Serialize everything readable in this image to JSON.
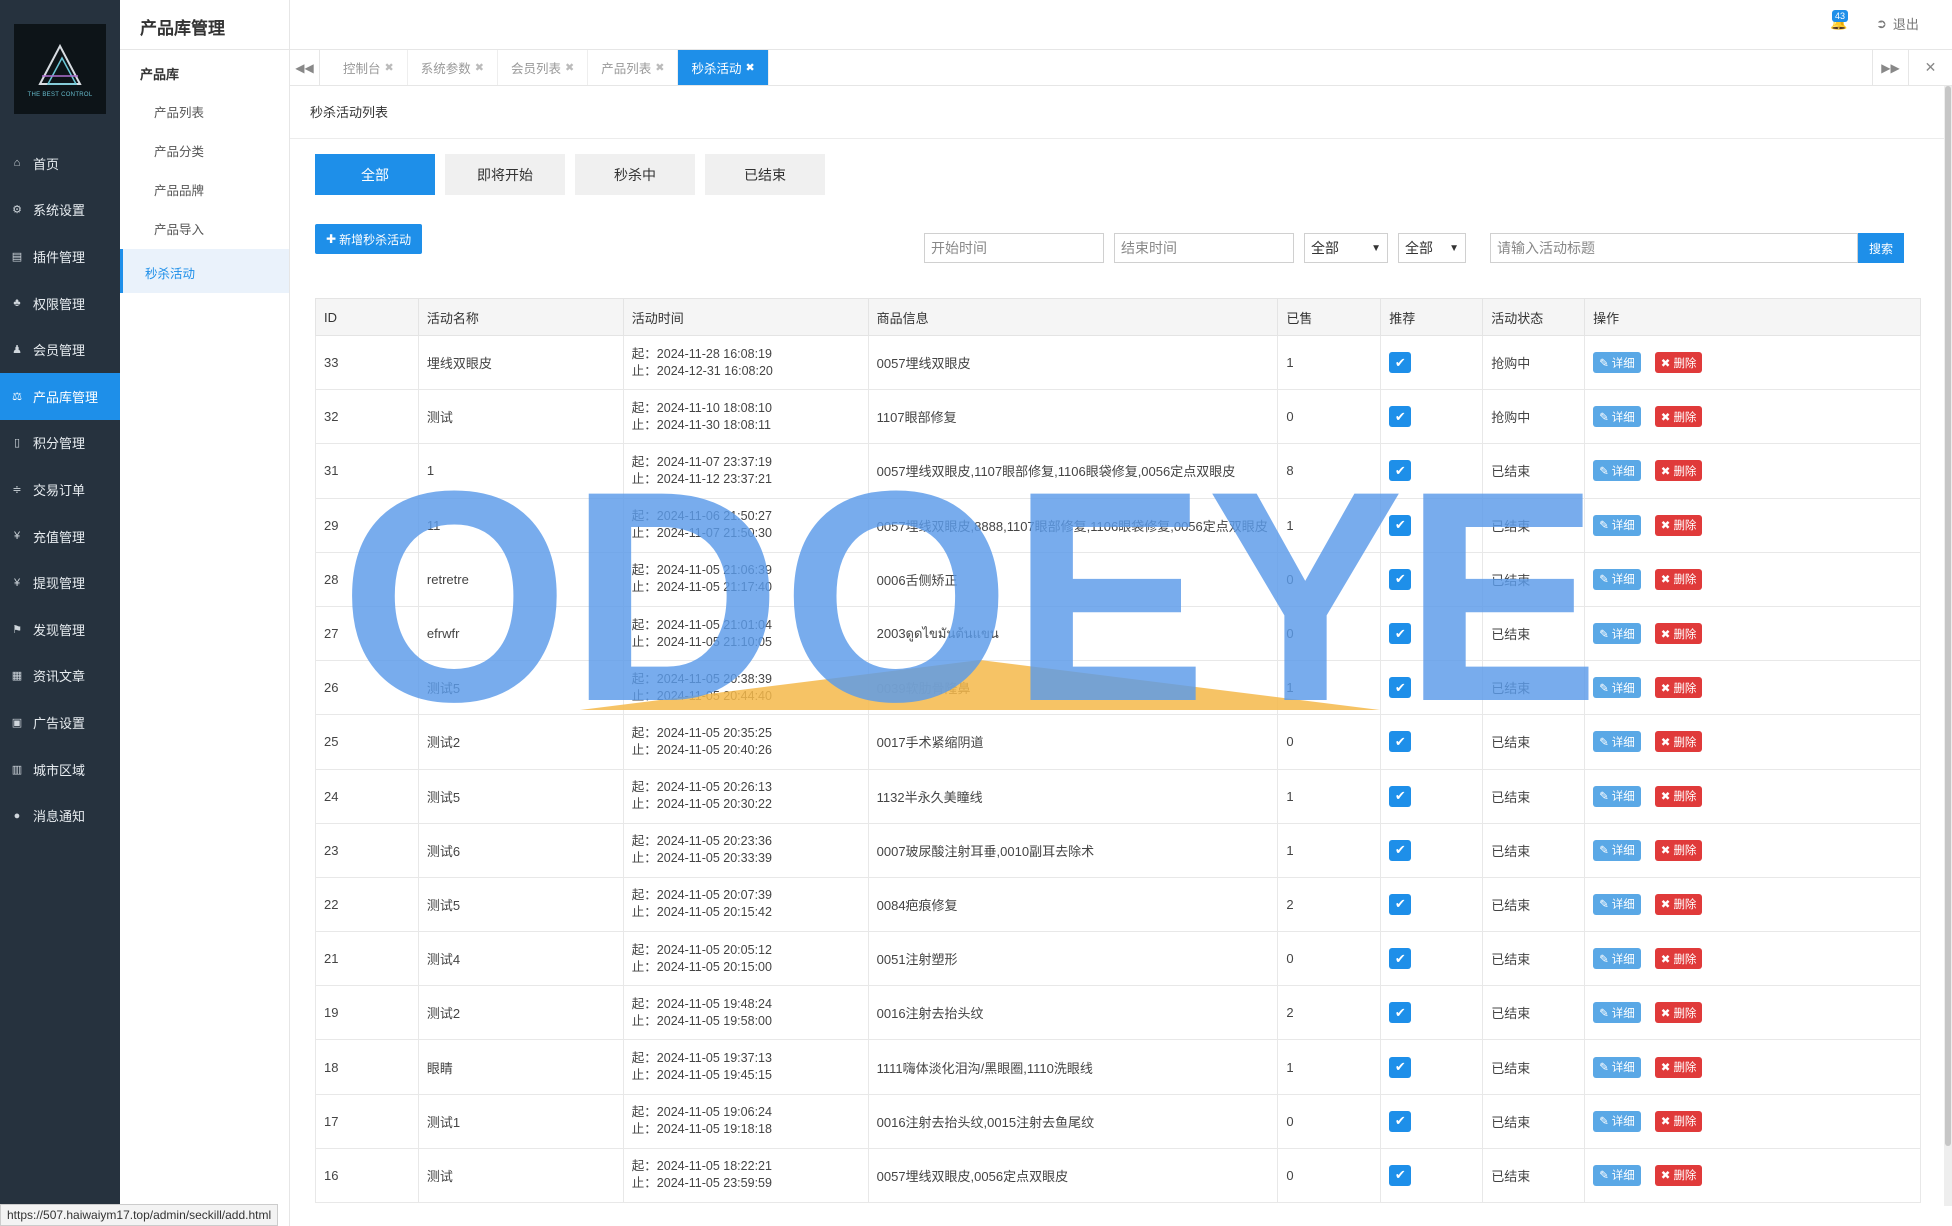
{
  "sidebar": {
    "logo_text": "THE BEST CONTROL",
    "items": [
      {
        "label": "首页",
        "icon": "home-icon",
        "glyph": "⌂"
      },
      {
        "label": "系统设置",
        "icon": "gear-icon",
        "glyph": "⚙"
      },
      {
        "label": "插件管理",
        "icon": "plugin-icon",
        "glyph": "▤"
      },
      {
        "label": "权限管理",
        "icon": "sitemap-icon",
        "glyph": "♣"
      },
      {
        "label": "会员管理",
        "icon": "users-icon",
        "glyph": "♟"
      },
      {
        "label": "产品库管理",
        "icon": "scale-icon",
        "glyph": "⚖"
      },
      {
        "label": "积分管理",
        "icon": "file-icon",
        "glyph": "▯"
      },
      {
        "label": "交易订单",
        "icon": "sliders-icon",
        "glyph": "≑"
      },
      {
        "label": "充值管理",
        "icon": "yen-icon",
        "glyph": "¥"
      },
      {
        "label": "提现管理",
        "icon": "yen-icon",
        "glyph": "¥"
      },
      {
        "label": "发现管理",
        "icon": "flag-icon",
        "glyph": "⚑"
      },
      {
        "label": "资讯文章",
        "icon": "newspaper-icon",
        "glyph": "▦"
      },
      {
        "label": "广告设置",
        "icon": "image-icon",
        "glyph": "▣"
      },
      {
        "label": "城市区域",
        "icon": "map-icon",
        "glyph": "▥"
      },
      {
        "label": "消息通知",
        "icon": "comment-icon",
        "glyph": "●"
      }
    ]
  },
  "subside": {
    "title": "产品库管理",
    "group": "产品库",
    "items": [
      "产品列表",
      "产品分类",
      "产品品牌",
      "产品导入"
    ],
    "active_item": "秒杀活动"
  },
  "topbar": {
    "notification_count": "43",
    "logout_label": "退出"
  },
  "tabs": [
    {
      "label": "控制台"
    },
    {
      "label": "系统参数"
    },
    {
      "label": "会员列表"
    },
    {
      "label": "产品列表"
    },
    {
      "label": "秒杀活动"
    }
  ],
  "panel": {
    "title": "秒杀活动列表",
    "filter_tabs": [
      "全部",
      "即将开始",
      "秒杀中",
      "已结束"
    ],
    "add_button": "新增秒杀活动",
    "search": {
      "start_placeholder": "开始时间",
      "end_placeholder": "结束时间",
      "select1_value": "全部",
      "select2_value": "全部",
      "title_placeholder": "请输入活动标题",
      "button": "搜索"
    }
  },
  "table": {
    "headers": [
      "ID",
      "活动名称",
      "活动时间",
      "商品信息",
      "已售",
      "推荐",
      "活动状态",
      "操作"
    ],
    "detail_label": "详细",
    "delete_label": "删除",
    "rows": [
      {
        "id": "33",
        "name": "埋线双眼皮",
        "start": "起：2024-11-28 16:08:19",
        "end": "止：2024-12-31 16:08:20",
        "goods": "0057埋线双眼皮",
        "sold": "1",
        "status": "抢购中",
        "active": true
      },
      {
        "id": "32",
        "name": "测试",
        "start": "起：2024-11-10 18:08:10",
        "end": "止：2024-11-30 18:08:11",
        "goods": "1107眼部修复",
        "sold": "0",
        "status": "抢购中",
        "active": true
      },
      {
        "id": "31",
        "name": "1",
        "start": "起：2024-11-07 23:37:19",
        "end": "止：2024-11-12 23:37:21",
        "goods": "0057埋线双眼皮,1107眼部修复,1106眼袋修复,0056定点双眼皮",
        "sold": "8",
        "status": "已结束",
        "active": false
      },
      {
        "id": "29",
        "name": "11",
        "start": "起：2024-11-06 21:50:27",
        "end": "止：2024-11-07 21:50:30",
        "goods": "0057埋线双眼皮,8888,1107眼部修复,1106眼袋修复,0056定点双眼皮",
        "sold": "1",
        "status": "已结束",
        "active": false
      },
      {
        "id": "28",
        "name": "retretre",
        "start": "起：2024-11-05 21:06:39",
        "end": "止：2024-11-05 21:17:40",
        "goods": "0006舌侧矫正",
        "sold": "0",
        "status": "已结束",
        "active": false
      },
      {
        "id": "27",
        "name": "efrwfr",
        "start": "起：2024-11-05 21:01:04",
        "end": "止：2024-11-05 21:10:05",
        "goods": "2003ดูดไขมันต้นแขน",
        "sold": "0",
        "status": "已结束",
        "active": false
      },
      {
        "id": "26",
        "name": "测试5",
        "start": "起：2024-11-05 20:38:39",
        "end": "止：2024-11-05 20:44:40",
        "goods": "0039软肋骨隆鼻",
        "sold": "1",
        "status": "已结束",
        "active": false
      },
      {
        "id": "25",
        "name": "测试2",
        "start": "起：2024-11-05 20:35:25",
        "end": "止：2024-11-05 20:40:26",
        "goods": "0017手术紧缩阴道",
        "sold": "0",
        "status": "已结束",
        "active": false
      },
      {
        "id": "24",
        "name": "测试5",
        "start": "起：2024-11-05 20:26:13",
        "end": "止：2024-11-05 20:30:22",
        "goods": "1132半永久美瞳线",
        "sold": "1",
        "status": "已结束",
        "active": false
      },
      {
        "id": "23",
        "name": "测试6",
        "start": "起：2024-11-05 20:23:36",
        "end": "止：2024-11-05 20:33:39",
        "goods": "0007玻尿酸注射耳垂,0010副耳去除术",
        "sold": "1",
        "status": "已结束",
        "active": false
      },
      {
        "id": "22",
        "name": "测试5",
        "start": "起：2024-11-05 20:07:39",
        "end": "止：2024-11-05 20:15:42",
        "goods": "0084疤痕修复",
        "sold": "2",
        "status": "已结束",
        "active": false
      },
      {
        "id": "21",
        "name": "测试4",
        "start": "起：2024-11-05 20:05:12",
        "end": "止：2024-11-05 20:15:00",
        "goods": "0051注射塑形",
        "sold": "0",
        "status": "已结束",
        "active": false
      },
      {
        "id": "19",
        "name": "测试2",
        "start": "起：2024-11-05 19:48:24",
        "end": "止：2024-11-05 19:58:00",
        "goods": "0016注射去抬头纹",
        "sold": "2",
        "status": "已结束",
        "active": false
      },
      {
        "id": "18",
        "name": "眼睛",
        "start": "起：2024-11-05 19:37:13",
        "end": "止：2024-11-05 19:45:15",
        "goods": "1111嗨体淡化泪沟/黑眼圈,1110洗眼线",
        "sold": "1",
        "status": "已结束",
        "active": false
      },
      {
        "id": "17",
        "name": "测试1",
        "start": "起：2024-11-05 19:06:24",
        "end": "止：2024-11-05 19:18:18",
        "goods": "0016注射去抬头纹,0015注射去鱼尾纹",
        "sold": "0",
        "status": "已结束",
        "active": false
      },
      {
        "id": "16",
        "name": "测试",
        "start": "起：2024-11-05 18:22:21",
        "end": "止：2024-11-05 23:59:59",
        "goods": "0057埋线双眼皮,0056定点双眼皮",
        "sold": "0",
        "status": "已结束",
        "active": false
      }
    ]
  },
  "statusbar": {
    "url": "https://507.haiwaiym17.top/admin/seckill/add.html"
  },
  "watermark": {
    "text": "ODOEYE"
  },
  "colors": {
    "accent": "#1e8fe9",
    "sidebar": "#26323e",
    "danger": "#e03535",
    "watermark_blue": "#5b9bea",
    "watermark_orange": "#f5b94a"
  }
}
